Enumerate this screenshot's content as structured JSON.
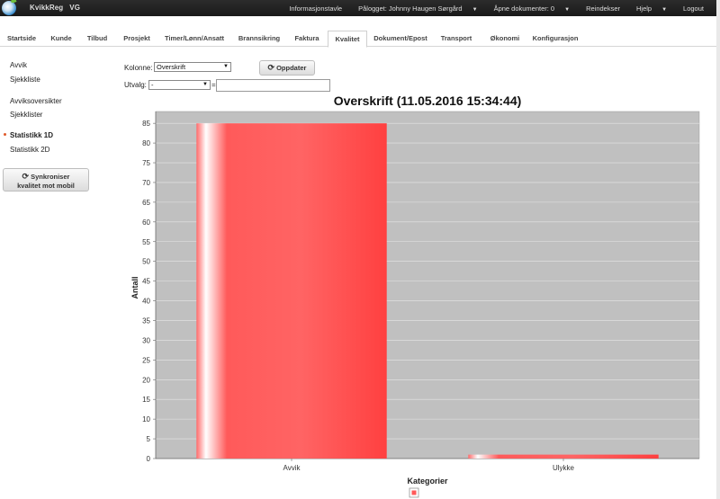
{
  "topbar": {
    "brand": "KvikkReg",
    "company": "VG",
    "nav": [
      {
        "label": "Informasjonstavle",
        "caret": false
      },
      {
        "label": "Pålogget: Johnny Haugen Sørgård",
        "caret": true
      },
      {
        "label": "Åpne dokumenter: 0",
        "caret": true
      },
      {
        "label": "Reindekser",
        "caret": false
      },
      {
        "label": "Hjelp",
        "caret": true
      },
      {
        "label": "Logout",
        "caret": false
      }
    ]
  },
  "tabs": [
    "Startside",
    "Kunde",
    "Tilbud",
    "Prosjekt",
    "Timer/Lønn/Ansatt",
    "Brannsikring",
    "Faktura",
    "Kvalitet",
    "Dokument/Epost",
    "Transport",
    "Økonomi",
    "Konfigurasjon"
  ],
  "active_tab": "Kvalitet",
  "sidebar": {
    "items": [
      "Avvik",
      "Sjekkliste",
      "Avviksoversikter",
      "Sjekklister",
      "Statistikk 1D",
      "Statistikk 2D"
    ],
    "active": "Statistikk 1D",
    "sync_button_line1": "Synkroniser",
    "sync_button_line2": "kvalitet mot mobil"
  },
  "filters": {
    "kolonne_label": "Kolonne:",
    "kolonne_value": "Overskrift",
    "utvalg_label": "Utvalg:",
    "utvalg_value": "-",
    "equals": "=",
    "update_button": "Oppdater"
  },
  "colors": {
    "bar": "#ff5a5a",
    "plot_bg": "#c0c0c0",
    "topbar": "#222222"
  },
  "chart_data": {
    "type": "bar",
    "title": "Overskrift (11.05.2016 15:34:44)",
    "xlabel": "Kategorier",
    "ylabel": "Antall",
    "categories": [
      "Avvik",
      "Ulykke"
    ],
    "values": [
      85,
      1
    ],
    "ylim": [
      0,
      88
    ],
    "yticks": [
      0,
      5,
      10,
      15,
      20,
      25,
      30,
      35,
      40,
      45,
      50,
      55,
      60,
      65,
      70,
      75,
      80,
      85
    ],
    "grid": true,
    "legend": "bottom"
  }
}
